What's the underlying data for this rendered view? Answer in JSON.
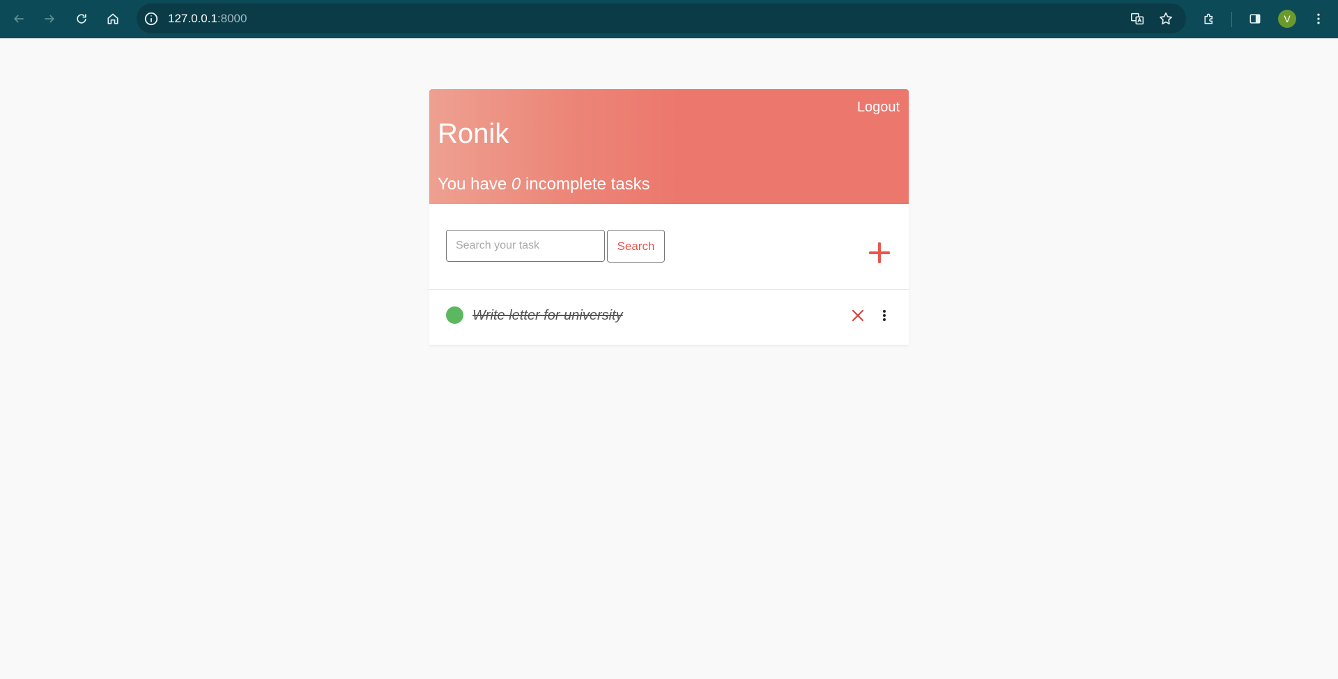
{
  "browser": {
    "url_host": "127.0.0.1",
    "url_port": ":8000",
    "profile_initial": "V",
    "icons": [
      "back-icon",
      "forward-icon",
      "reload-icon",
      "home-icon",
      "site-info-icon",
      "translate-icon",
      "bookmark-star-icon",
      "extensions-icon",
      "side-panel-icon",
      "menu-kebab-icon"
    ]
  },
  "header": {
    "logout_label": "Logout",
    "user_name": "Ronik",
    "subtitle_prefix": "You have ",
    "incomplete_count": "0",
    "subtitle_suffix": " incomplete tasks",
    "gradient_start": "#eea091",
    "gradient_end": "#ec776d"
  },
  "search": {
    "placeholder": "Search your task",
    "value": "",
    "button_label": "Search"
  },
  "tasks": [
    {
      "title": "Write letter for university",
      "completed": true,
      "status_color": "#5cb860"
    }
  ],
  "colors": {
    "accent": "#e8574c",
    "chrome": "#0d4a57"
  }
}
